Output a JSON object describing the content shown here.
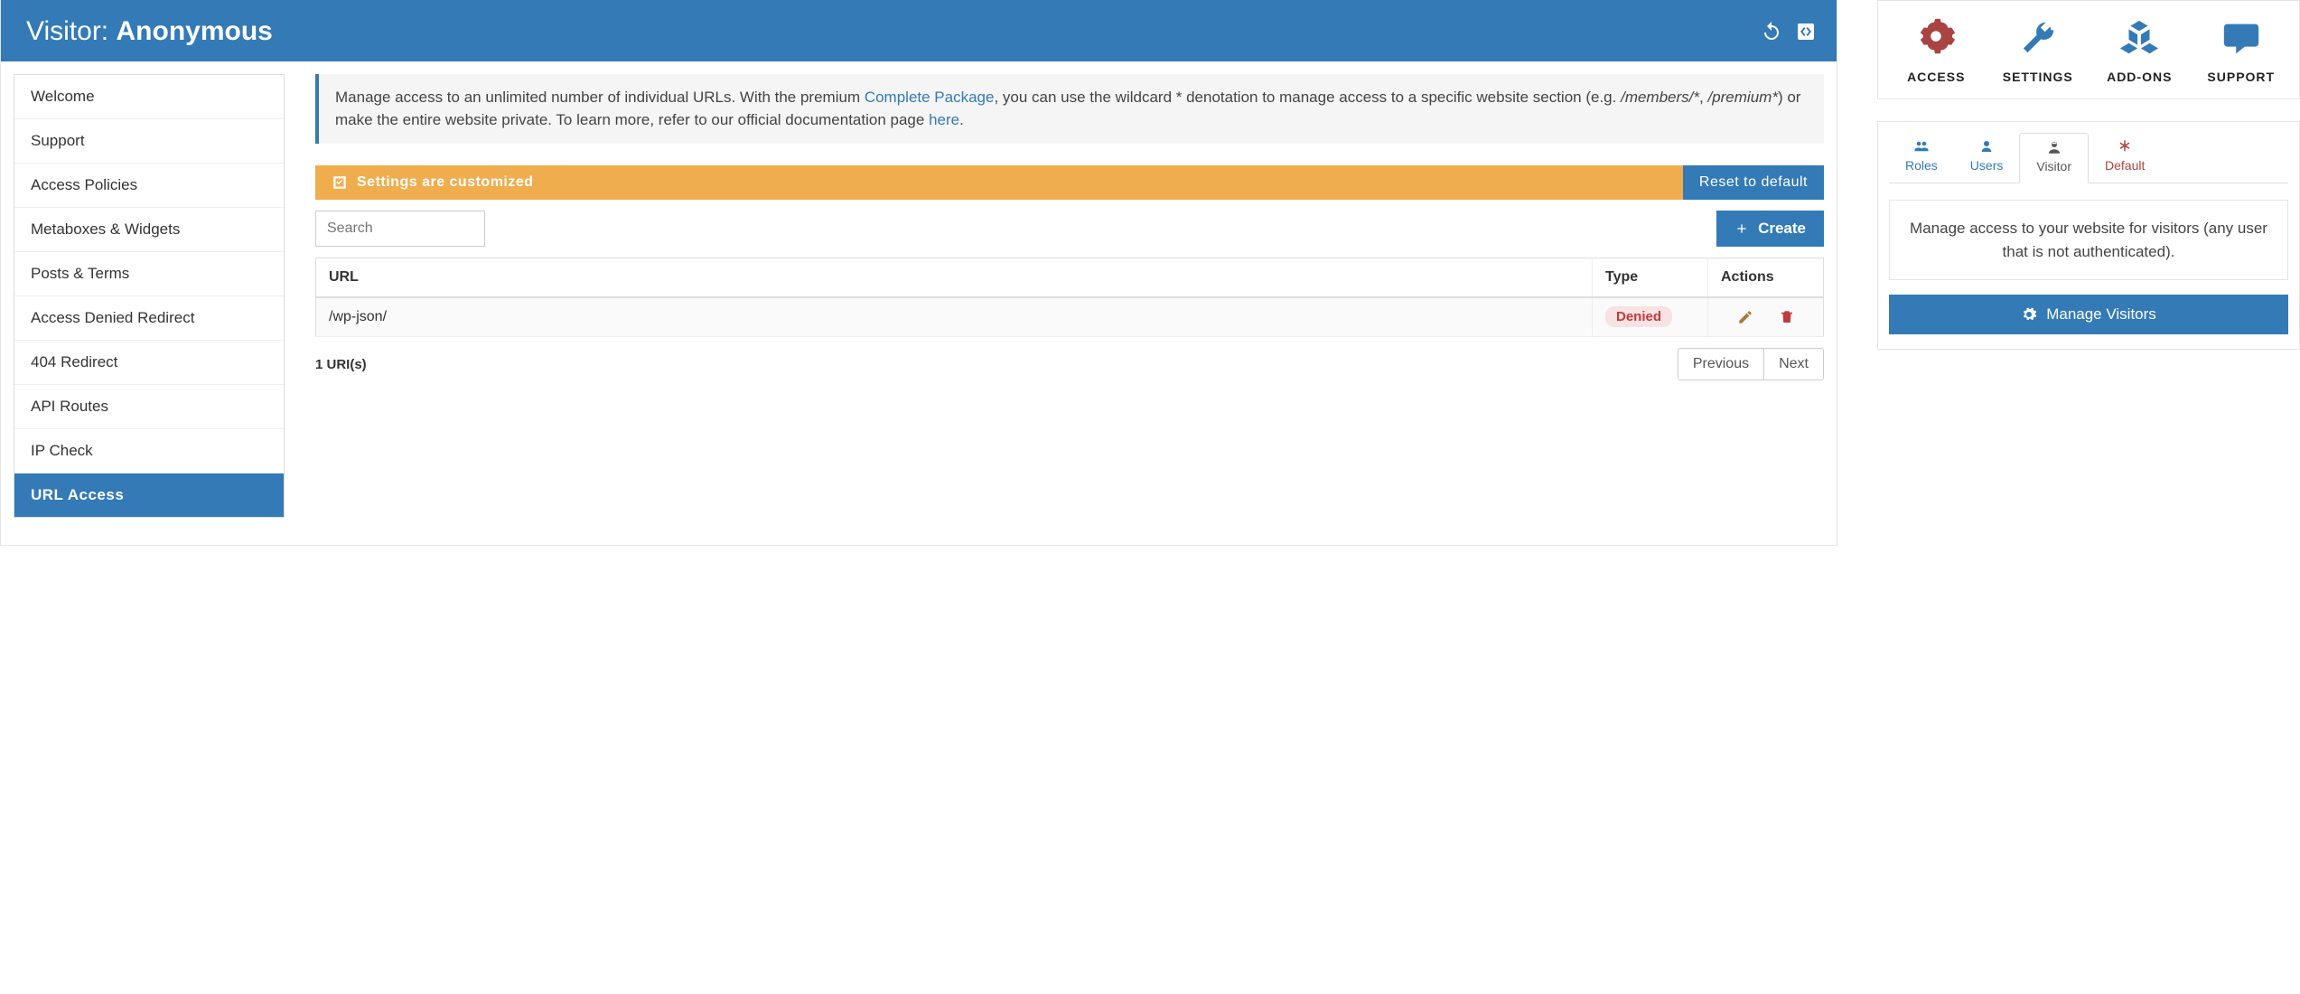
{
  "header": {
    "prefix": "Visitor:",
    "name": "Anonymous"
  },
  "sidenav": [
    {
      "label": "Welcome",
      "active": false
    },
    {
      "label": "Support",
      "active": false
    },
    {
      "label": "Access Policies",
      "active": false
    },
    {
      "label": "Metaboxes & Widgets",
      "active": false
    },
    {
      "label": "Posts & Terms",
      "active": false
    },
    {
      "label": "Access Denied Redirect",
      "active": false
    },
    {
      "label": "404 Redirect",
      "active": false
    },
    {
      "label": "API Routes",
      "active": false
    },
    {
      "label": "IP Check",
      "active": false
    },
    {
      "label": "URL Access",
      "active": true
    }
  ],
  "info": {
    "text_before_link": "Manage access to an unlimited number of individual URLs. With the premium ",
    "link1_label": "Complete Package",
    "text_mid": ", you can use the wildcard * denotation to manage access to a specific website section (e.g. ",
    "em1": "/members/*",
    "sep": ", ",
    "em2": "/premium*",
    "text_after_em": ") or make the entire website private. To learn more, refer to our official documentation page ",
    "link2_label": "here",
    "period": "."
  },
  "customize_bar": {
    "message": "Settings are customized",
    "reset_label": "Reset to default"
  },
  "toolbar": {
    "search_placeholder": "Search",
    "create_label": "Create"
  },
  "table": {
    "headers": {
      "url": "URL",
      "type": "Type",
      "actions": "Actions"
    },
    "rows": [
      {
        "url": "/wp-json/",
        "type_label": "Denied"
      }
    ],
    "count_label": "1 URI(s)",
    "prev_label": "Previous",
    "next_label": "Next"
  },
  "top_nav": [
    {
      "label": "ACCESS",
      "icon": "gears-icon",
      "class": "access"
    },
    {
      "label": "SETTINGS",
      "icon": "wrench-icon",
      "class": ""
    },
    {
      "label": "ADD-ONS",
      "icon": "cubes-icon",
      "class": ""
    },
    {
      "label": "SUPPORT",
      "icon": "chat-icon",
      "class": ""
    }
  ],
  "right_tabs": [
    {
      "label": "Roles",
      "icon": "group-icon",
      "state": ""
    },
    {
      "label": "Users",
      "icon": "user-icon",
      "state": ""
    },
    {
      "label": "Visitor",
      "icon": "visitor-icon",
      "state": "active"
    },
    {
      "label": "Default",
      "icon": "asterisk-icon",
      "state": "danger"
    }
  ],
  "right_panel": {
    "description": "Manage access to your website for visitors (any user that is not authenticated).",
    "button_label": "Manage Visitors"
  }
}
